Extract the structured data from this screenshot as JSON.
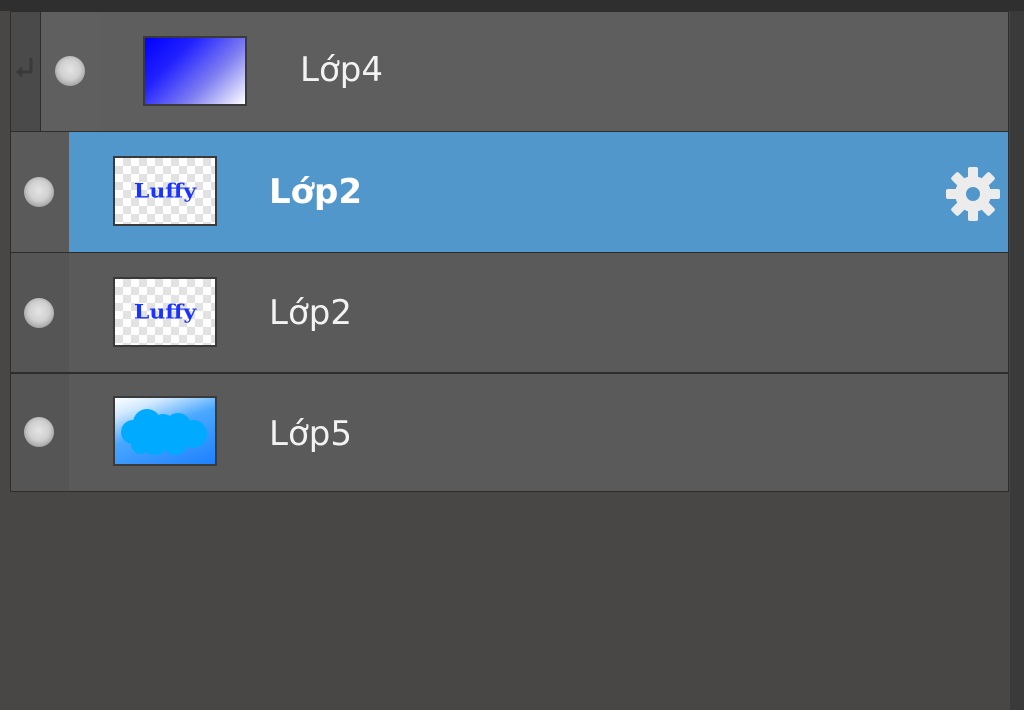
{
  "layers_panel": {
    "layers": [
      {
        "name": "Lớp4",
        "thumbnail": "blue-gradient",
        "clipped": true,
        "selected": false,
        "visible": true
      },
      {
        "name": "Lớp2",
        "thumbnail": "text-on-transparent",
        "thumbnail_text": "Luffy",
        "clipped": false,
        "selected": true,
        "visible": true,
        "options_icon": "gear-icon"
      },
      {
        "name": "Lớp2",
        "thumbnail": "text-on-transparent",
        "thumbnail_text": "Luffy",
        "clipped": false,
        "selected": false,
        "visible": true
      },
      {
        "name": "Lớp5",
        "thumbnail": "sky-cloud",
        "clipped": false,
        "selected": false,
        "visible": true
      }
    ],
    "colors": {
      "selected_row": "#5297cc",
      "row": "#5a5a5a",
      "panel_bg": "#484746"
    }
  }
}
